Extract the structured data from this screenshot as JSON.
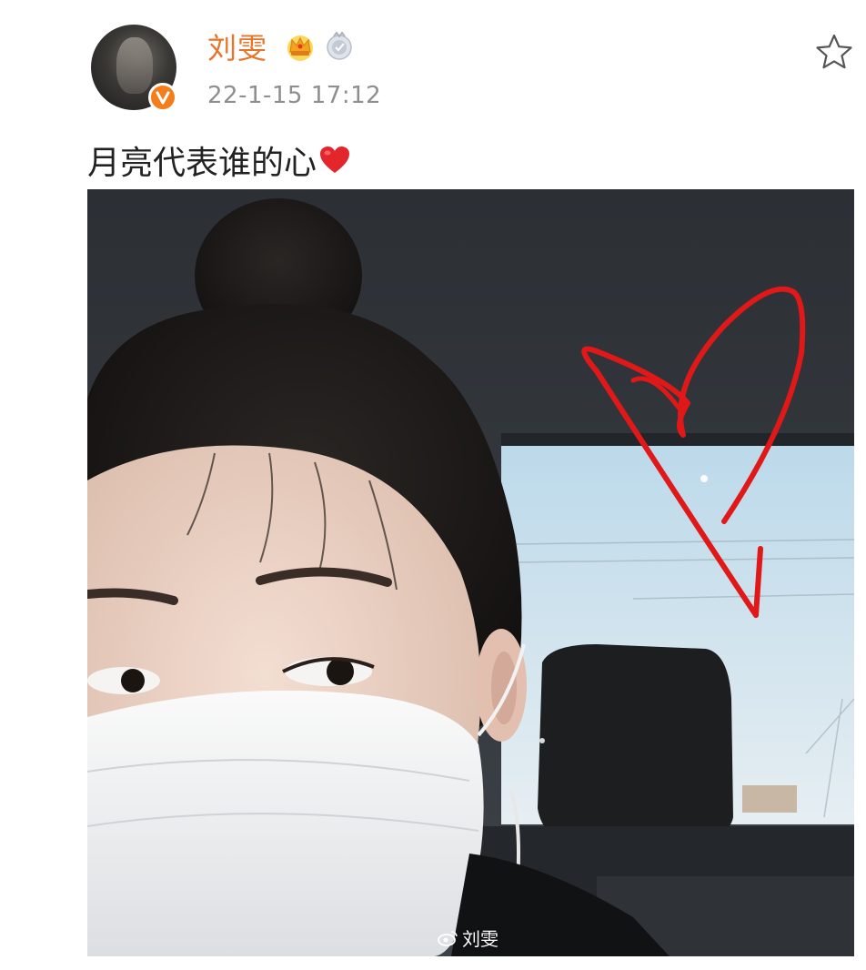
{
  "post": {
    "author": {
      "name": "刘雯",
      "avatar_icon": "user-avatar",
      "verified_icon": "verified-v-icon",
      "badges": [
        "crown-badge-icon",
        "level-badge-icon"
      ]
    },
    "timestamp": "22-1-15 17:12",
    "text": "月亮代表谁的心",
    "text_emoji": "red-heart-icon",
    "favorite_icon": "star-icon",
    "image": {
      "description_icon": "selfie-photo",
      "watermark": "刘雯"
    }
  },
  "colors": {
    "username": "#e8742a",
    "timestamp": "#8e8e8e",
    "text": "#222222",
    "verified": "#f47e1c",
    "heart_drawing": "#e01818"
  }
}
